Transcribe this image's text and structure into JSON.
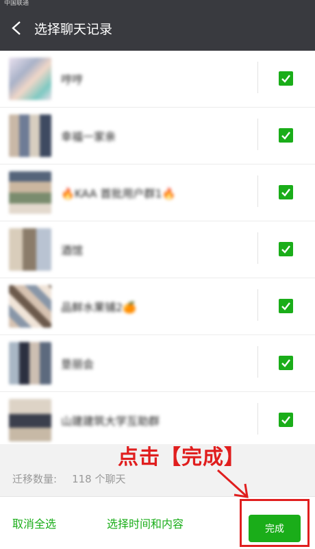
{
  "status": {
    "carrier": "中国联通"
  },
  "header": {
    "title": "选择聊天记录"
  },
  "chats": [
    {
      "name": "哼哼"
    },
    {
      "name": "幸福一家亲"
    },
    {
      "name": "🔥KAA 首批用户群1🔥"
    },
    {
      "name": "酒馆"
    },
    {
      "name": "品鲜水果铺2🍊"
    },
    {
      "name": "垦丽会"
    },
    {
      "name": "山建建筑大学互助群"
    }
  ],
  "migration": {
    "label": "迁移数量:",
    "count": "118 个聊天"
  },
  "footer": {
    "select_all": "取消全选",
    "select_time": "选择时间和内容",
    "done": "完成"
  },
  "annotation": {
    "text": "点击【完成】"
  },
  "colors": {
    "header_bg": "#393a3f",
    "accent": "#1aad19",
    "annotation": "#e01e1e"
  }
}
